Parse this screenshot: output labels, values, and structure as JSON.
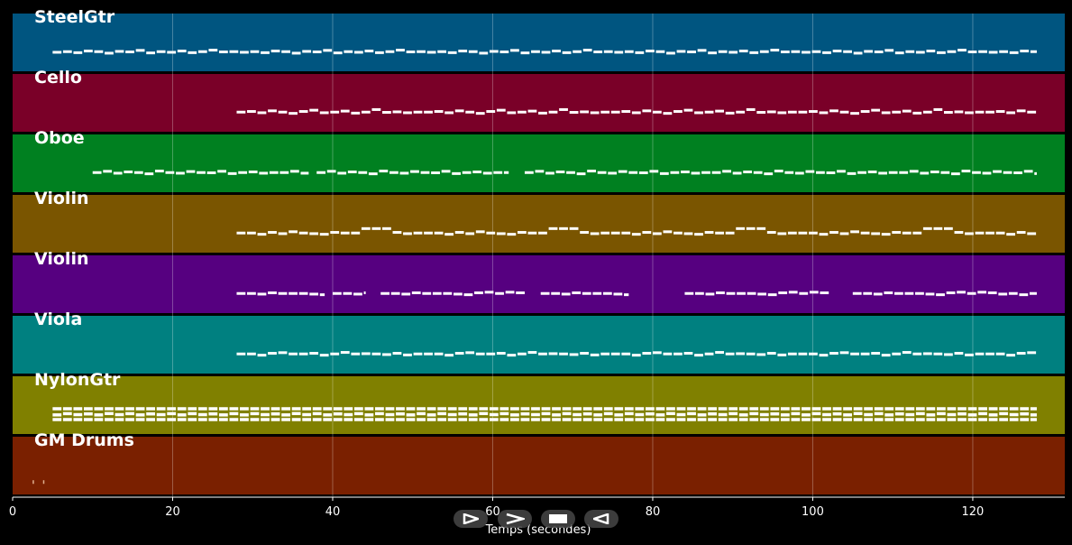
{
  "chart_data": {
    "type": "piano-roll",
    "xlabel": "Temps (secondes)",
    "xlim": [
      0,
      131.5
    ],
    "xticks": [
      0,
      20,
      40,
      60,
      80,
      100,
      120
    ],
    "grid": true,
    "tracks": [
      {
        "name": "SteelGtr",
        "color": "#005580",
        "segments": [
          [
            5,
            128
          ]
        ],
        "profile": [
          0.45,
          0.5,
          0.42,
          0.55,
          0.5,
          0.38,
          0.52,
          0.48,
          0.6,
          0.4,
          0.5,
          0.45,
          0.55,
          0.42,
          0.5,
          0.62,
          0.48,
          0.5
        ]
      },
      {
        "name": "Cello",
        "color": "#7a0028",
        "segments": [
          [
            28,
            128
          ]
        ],
        "profile": [
          0.5,
          0.55,
          0.45,
          0.6,
          0.5,
          0.4,
          0.55,
          0.65,
          0.45,
          0.5,
          0.58,
          0.42,
          0.5,
          0.7,
          0.48,
          0.52,
          0.45,
          0.5
        ]
      },
      {
        "name": "Oboe",
        "color": "#008020",
        "segments": [
          [
            10,
            37
          ],
          [
            38,
            62
          ],
          [
            64,
            128
          ]
        ],
        "profile": [
          0.5,
          0.6,
          0.45,
          0.55,
          0.5,
          0.4,
          0.62,
          0.5,
          0.45,
          0.58,
          0.5,
          0.48,
          0.6,
          0.42,
          0.5,
          0.55,
          0.45,
          0.5
        ]
      },
      {
        "name": "Violin",
        "color": "#7a5500",
        "segments": [
          [
            28,
            128
          ]
        ],
        "profile": [
          0.5,
          0.5,
          0.4,
          0.55,
          0.45,
          0.6,
          0.5,
          0.45,
          0.4,
          0.55,
          0.5,
          0.5,
          0.85,
          0.85,
          0.85,
          0.55,
          0.45,
          0.5
        ]
      },
      {
        "name": "Violin",
        "color": "#560080",
        "segments": [
          [
            28,
            39
          ],
          [
            40,
            44
          ],
          [
            46,
            64
          ],
          [
            66,
            77
          ],
          [
            84,
            102
          ],
          [
            105,
            128
          ]
        ],
        "profile": [
          0.5,
          0.5,
          0.45,
          0.55,
          0.5,
          0.5,
          0.5,
          0.45,
          0.4,
          0.55,
          0.6,
          0.5,
          0.6,
          0.55,
          0.45,
          0.5,
          0.4,
          0.5
        ]
      },
      {
        "name": "Viola",
        "color": "#008080",
        "segments": [
          [
            28,
            128
          ]
        ],
        "profile": [
          0.5,
          0.5,
          0.4,
          0.55,
          0.6,
          0.5,
          0.5,
          0.55,
          0.4,
          0.5,
          0.62,
          0.5,
          0.52,
          0.5,
          0.45,
          0.55,
          0.42,
          0.5
        ]
      },
      {
        "name": "NylonGtr",
        "color": "#808000",
        "segments": [
          [
            5,
            128
          ]
        ],
        "profile": [
          0.35,
          0.6,
          0.4,
          0.55,
          0.35,
          0.62,
          0.4,
          0.6,
          0.35,
          0.55,
          0.4,
          0.6,
          0.35,
          0.6,
          0.4,
          0.55,
          0.35,
          0.6
        ]
      },
      {
        "name": "GM Drums",
        "color": "#7a2000",
        "segments": [
          [
            2.5,
            4.8
          ]
        ],
        "profile": [
          0.7
        ]
      }
    ]
  },
  "controls": {
    "play": "play-icon",
    "forward": "fast-forward-icon",
    "stop": "stop-icon",
    "back": "rewind-icon"
  }
}
